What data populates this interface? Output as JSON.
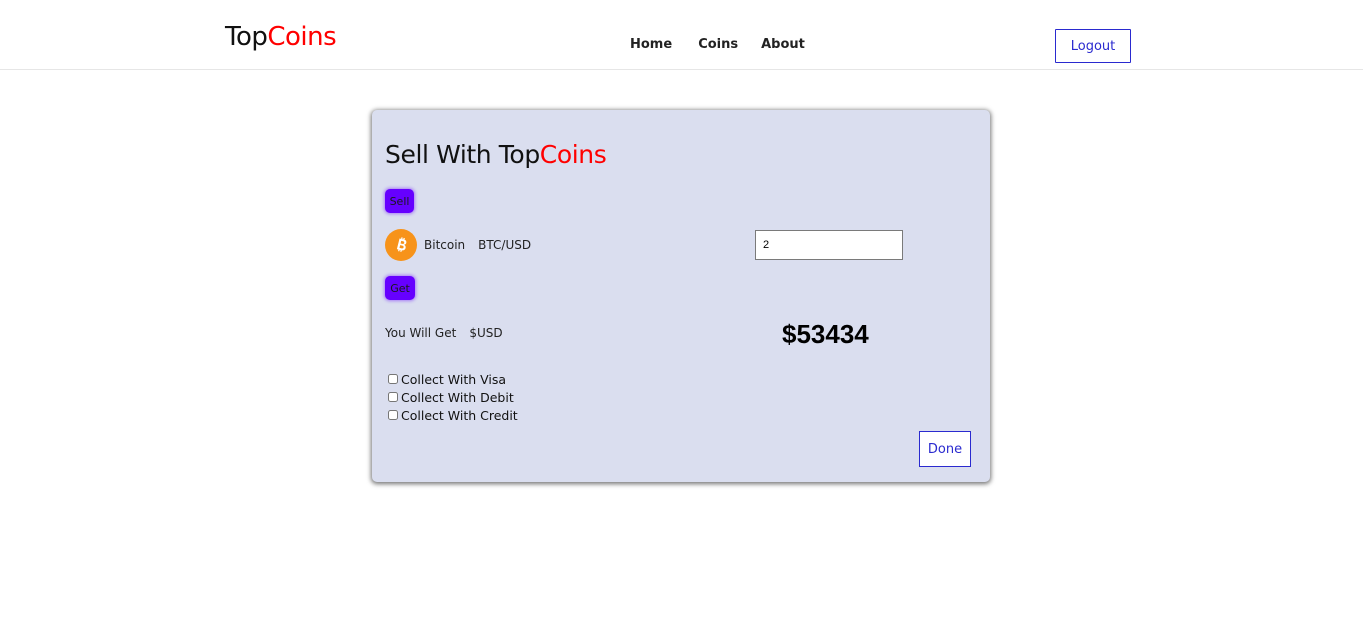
{
  "header": {
    "logo_part1": "Top",
    "logo_part2": "Coins",
    "nav": [
      "Home",
      "Coins",
      "About"
    ],
    "logout_label": "Logout"
  },
  "card": {
    "title_part1": "Sell With Top",
    "title_part2": "Coins",
    "sell_label": "Sell",
    "get_label": "Get",
    "coin": {
      "icon": "bitcoin-icon",
      "name": "Bitcoin",
      "pair": "BTC/USD"
    },
    "amount_value": "2",
    "receive": {
      "label": "You Will Get",
      "currency": "$USD",
      "amount": "$53434"
    },
    "options": [
      {
        "label": "Collect With Visa",
        "checked": false
      },
      {
        "label": "Collect With Debit",
        "checked": false
      },
      {
        "label": "Collect With Credit",
        "checked": false
      }
    ],
    "done_label": "Done"
  },
  "colors": {
    "accent_red": "#ff0000",
    "button_purple": "#6600ff",
    "link_blue": "#2a2acf",
    "card_bg": "#dadeef",
    "bitcoin_orange": "#f7931a"
  }
}
